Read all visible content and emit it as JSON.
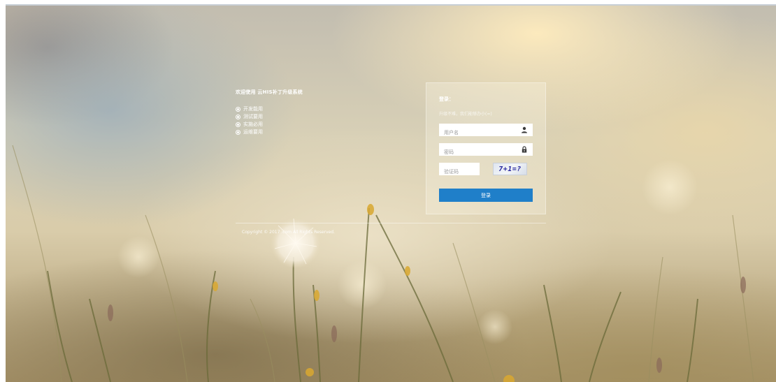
{
  "welcome": {
    "title": "欢迎使用 云HIS补丁升级系统",
    "features": [
      "开发能用",
      "测试要用",
      "实施必用",
      "运维要用"
    ]
  },
  "login": {
    "title": "登录：",
    "hint": "升级不难，我们能够办小(=)",
    "username_placeholder": "用户名",
    "password_placeholder": "密码",
    "captcha_placeholder": "验证码",
    "captcha_text": "7+1=?",
    "submit_label": "登录"
  },
  "footer": {
    "copyright": "Copyright © 2017 .com All Rights Reserved."
  },
  "icons": {
    "username": "user-icon",
    "password": "lock-icon",
    "bullet": "radio-bullet-icon"
  },
  "colors": {
    "button": "#1f7fc9",
    "text": "#ffffff"
  }
}
